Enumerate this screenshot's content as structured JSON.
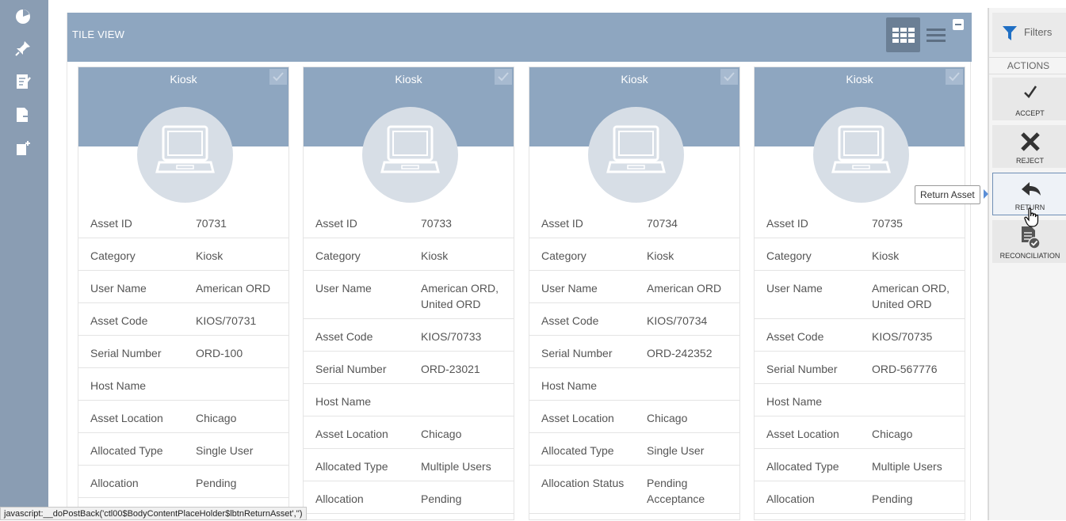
{
  "header": {
    "title": "TILE VIEW"
  },
  "leftnav": {
    "icons": [
      "pie-chart-icon",
      "pin-icon",
      "edit-document-icon",
      "export-document-icon",
      "new-document-icon"
    ]
  },
  "cards": [
    {
      "title": "Kiosk",
      "rows": [
        {
          "key": "Asset ID",
          "value": "70731"
        },
        {
          "key": "Category",
          "value": "Kiosk"
        },
        {
          "key": "User Name",
          "value": "American ORD"
        },
        {
          "key": "Asset Code",
          "value": "KIOS/70731"
        },
        {
          "key": "Serial Number",
          "value": "ORD-100"
        },
        {
          "key": "Host Name",
          "value": ""
        },
        {
          "key": "Asset Location",
          "value": "Chicago"
        },
        {
          "key": "Allocated Type",
          "value": "Single User"
        },
        {
          "key": "Allocation",
          "value": "Pending"
        }
      ]
    },
    {
      "title": "Kiosk",
      "rows": [
        {
          "key": "Asset ID",
          "value": "70733"
        },
        {
          "key": "Category",
          "value": "Kiosk"
        },
        {
          "key": "User Name",
          "value": "American ORD, United ORD"
        },
        {
          "key": "Asset Code",
          "value": "KIOS/70733"
        },
        {
          "key": "Serial Number",
          "value": "ORD-23021"
        },
        {
          "key": "Host Name",
          "value": ""
        },
        {
          "key": "Asset Location",
          "value": "Chicago"
        },
        {
          "key": "Allocated Type",
          "value": "Multiple Users"
        },
        {
          "key": "Allocation",
          "value": "Pending"
        }
      ]
    },
    {
      "title": "Kiosk",
      "rows": [
        {
          "key": "Asset ID",
          "value": "70734"
        },
        {
          "key": "Category",
          "value": "Kiosk"
        },
        {
          "key": "User Name",
          "value": "American ORD"
        },
        {
          "key": "Asset Code",
          "value": "KIOS/70734"
        },
        {
          "key": "Serial Number",
          "value": "ORD-242352"
        },
        {
          "key": "Host Name",
          "value": ""
        },
        {
          "key": "Asset Location",
          "value": "Chicago"
        },
        {
          "key": "Allocated Type",
          "value": "Single User"
        },
        {
          "key": "Allocation Status",
          "value": "Pending Acceptance"
        }
      ]
    },
    {
      "title": "Kiosk",
      "rows": [
        {
          "key": "Asset ID",
          "value": "70735"
        },
        {
          "key": "Category",
          "value": "Kiosk"
        },
        {
          "key": "User Name",
          "value": "American ORD, United ORD"
        },
        {
          "key": "Asset Code",
          "value": "KIOS/70735"
        },
        {
          "key": "Serial Number",
          "value": "ORD-567776"
        },
        {
          "key": "Host Name",
          "value": ""
        },
        {
          "key": "Asset Location",
          "value": "Chicago"
        },
        {
          "key": "Allocated Type",
          "value": "Multiple Users"
        },
        {
          "key": "Allocation",
          "value": "Pending"
        }
      ]
    }
  ],
  "panel": {
    "filters_label": "Filters",
    "actions_header": "ACTIONS",
    "accept_label": "ACCEPT",
    "reject_label": "REJECT",
    "return_label": "RETURN",
    "reconciliation_label": "RECONCILIATION"
  },
  "tooltip": "Return Asset",
  "status_bar": "javascript:__doPostBack('ctl00$BodyContentPlaceHolder$lbtnReturnAsset','')",
  "colors": {
    "header": "#8ea6c0",
    "nav": "#8a9db3",
    "active_toggle": "#6b7f95",
    "filter_icon": "#1f6fc4"
  }
}
